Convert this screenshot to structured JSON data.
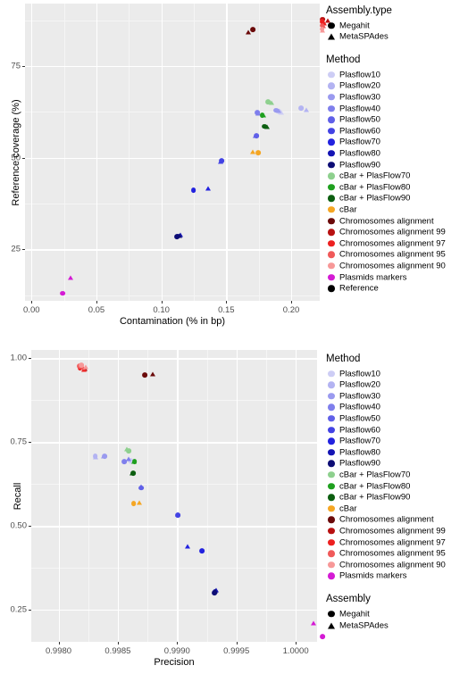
{
  "figure": {
    "palette": {
      "panel_bg": "#ebebeb",
      "grid_major": "#ffffff",
      "grid_minor": "#f5f5f5",
      "tick_text": "#4d4d4d",
      "axis_text": "#000000"
    },
    "method_colors": {
      "Plasflow10": "#cdcdf5",
      "Plasflow20": "#b3b3f2",
      "Plasflow30": "#9a9aef",
      "Plasflow40": "#7f7fec",
      "Plasflow50": "#6060e8",
      "Plasflow60": "#4343e4",
      "Plasflow70": "#2222df",
      "Plasflow80": "#1414b4",
      "Plasflow90": "#0d0d75",
      "cBar + PlasFlow70": "#8ed08e",
      "cBar + PlasFlow80": "#1fa01f",
      "cBar + PlasFlow90": "#0c5e10",
      "cBar": "#f5a623",
      "Chromosomes alignment": "#6b0a0a",
      "Chromosomes alignment 99": "#b81111",
      "Chromosomes alignment 97": "#ed2020",
      "Chromosomes alignment 95": "#f05a5a",
      "Chromosomes alignment 90": "#f79898",
      "Plasmids markers": "#d41bd4",
      "Reference": "#000000"
    },
    "assembly_shapes": {
      "Megahit": "circle",
      "MetaSPAdes": "triangle"
    }
  },
  "chart_data": [
    {
      "id": "top",
      "type": "scatter",
      "title": "",
      "xlabel": "Contamination (% in bp)",
      "ylabel": "Reference coverage (%)",
      "xlim": [
        -0.005,
        0.222
      ],
      "ylim": [
        11.0,
        92.0
      ],
      "xticks": [
        0.0,
        0.05,
        0.1,
        0.15,
        0.2
      ],
      "xtick_labels": [
        "0.00",
        "0.05",
        "0.10",
        "0.15",
        "0.20"
      ],
      "yticks": [
        25,
        50,
        75
      ],
      "ytick_labels": [
        "25",
        "50",
        "75"
      ],
      "grid": true,
      "legend_position": "right",
      "legends": [
        "Assembly.type",
        "Method"
      ],
      "points": [
        {
          "method": "Plasflow10",
          "assembly": "Megahit",
          "x": 0.1715,
          "y": 63.5
        },
        {
          "method": "Plasflow10",
          "assembly": "MetaSPAdes",
          "x": 0.1735,
          "y": 63.4
        },
        {
          "method": "Plasflow20",
          "assembly": "Megahit",
          "x": 0.1885,
          "y": 64.4
        },
        {
          "method": "Plasflow20",
          "assembly": "MetaSPAdes",
          "x": 0.1925,
          "y": 64.0
        },
        {
          "method": "Plasflow30",
          "assembly": "Megahit",
          "x": 0.169,
          "y": 63.9
        },
        {
          "method": "Plasflow30",
          "assembly": "MetaSPAdes",
          "x": 0.171,
          "y": 63.8
        },
        {
          "method": "Plasflow40",
          "assembly": "Megahit",
          "x": 0.1545,
          "y": 63.3
        },
        {
          "method": "Plasflow40",
          "assembly": "MetaSPAdes",
          "x": 0.1555,
          "y": 63.1
        },
        {
          "method": "Plasflow50",
          "assembly": "Megahit",
          "x": 0.154,
          "y": 57.0
        },
        {
          "method": "Plasflow50",
          "assembly": "MetaSPAdes",
          "x": 0.153,
          "y": 56.9
        },
        {
          "method": "Plasflow60",
          "assembly": "Megahit",
          "x": 0.127,
          "y": 50.1
        },
        {
          "method": "Plasflow60",
          "assembly": "MetaSPAdes",
          "x": 0.1265,
          "y": 50.0
        },
        {
          "method": "Plasflow70",
          "assembly": "Megahit",
          "x": 0.1055,
          "y": 42.1
        },
        {
          "method": "Plasflow70",
          "assembly": "MetaSPAdes",
          "x": 0.1165,
          "y": 42.6
        },
        {
          "method": "Plasflow80",
          "assembly": "Megahit",
          "x": 0.0935,
          "y": 29.6
        },
        {
          "method": "Plasflow80",
          "assembly": "MetaSPAdes",
          "x": 0.0955,
          "y": 30.0
        },
        {
          "method": "Plasflow90",
          "assembly": "Megahit",
          "x": 0.093,
          "y": 29.5
        },
        {
          "method": "Plasflow90",
          "assembly": "MetaSPAdes",
          "x": 0.095,
          "y": 29.8
        },
        {
          "method": "cBar + PlasFlow70",
          "assembly": "Megahit",
          "x": 0.163,
          "y": 66.2
        },
        {
          "method": "cBar + PlasFlow70",
          "assembly": "MetaSPAdes",
          "x": 0.1655,
          "y": 66.0
        },
        {
          "method": "cBar + PlasFlow80",
          "assembly": "Megahit",
          "x": 0.1585,
          "y": 62.6
        },
        {
          "method": "cBar + PlasFlow80",
          "assembly": "MetaSPAdes",
          "x": 0.1595,
          "y": 62.5
        },
        {
          "method": "cBar + PlasFlow90",
          "assembly": "Megahit",
          "x": 0.16,
          "y": 59.5
        },
        {
          "method": "cBar + PlasFlow90",
          "assembly": "MetaSPAdes",
          "x": 0.162,
          "y": 59.5
        },
        {
          "method": "cBar",
          "assembly": "Megahit",
          "x": 0.1555,
          "y": 52.3
        },
        {
          "method": "cBar",
          "assembly": "MetaSPAdes",
          "x": 0.151,
          "y": 52.5
        },
        {
          "method": "Chromosomes alignment",
          "assembly": "Megahit",
          "x": 0.151,
          "y": 85.9
        },
        {
          "method": "Chromosomes alignment",
          "assembly": "MetaSPAdes",
          "x": 0.1475,
          "y": 85.3
        },
        {
          "method": "Chromosomes alignment 99",
          "assembly": "Megahit",
          "x": 0.205,
          "y": 88.7
        },
        {
          "method": "Chromosomes alignment 99",
          "assembly": "MetaSPAdes",
          "x": 0.209,
          "y": 88.3
        },
        {
          "method": "Chromosomes alignment 97",
          "assembly": "Megahit",
          "x": 0.2045,
          "y": 88.0
        },
        {
          "method": "Chromosomes alignment 97",
          "assembly": "MetaSPAdes",
          "x": 0.2065,
          "y": 87.6
        },
        {
          "method": "Chromosomes alignment 95",
          "assembly": "Megahit",
          "x": 0.2045,
          "y": 87.0
        },
        {
          "method": "Chromosomes alignment 95",
          "assembly": "MetaSPAdes",
          "x": 0.2055,
          "y": 86.8
        },
        {
          "method": "Chromosomes alignment 90",
          "assembly": "Megahit",
          "x": 0.2045,
          "y": 86.0
        },
        {
          "method": "Chromosomes alignment 90",
          "assembly": "MetaSPAdes",
          "x": 0.205,
          "y": 85.7
        },
        {
          "method": "Plasmids markers",
          "assembly": "Megahit",
          "x": 0.0045,
          "y": 14.0
        },
        {
          "method": "Plasmids markers",
          "assembly": "MetaSPAdes",
          "x": 0.0105,
          "y": 18.2
        }
      ]
    },
    {
      "id": "bottom",
      "type": "scatter",
      "title": "",
      "xlabel": "Precision",
      "ylabel": "Recall",
      "xlim": [
        0.99777,
        1.00018
      ],
      "ylim": [
        0.155,
        1.025
      ],
      "xticks": [
        0.998,
        0.9985,
        0.999,
        0.9995,
        1.0
      ],
      "xtick_labels": [
        "0.9980",
        "0.9985",
        "0.9990",
        "0.9995",
        "1.0000"
      ],
      "yticks": [
        0.25,
        0.5,
        0.75,
        1.0
      ],
      "ytick_labels": [
        "0.25",
        "0.50",
        "0.75",
        "1.00"
      ],
      "grid": true,
      "legend_position": "right",
      "legends": [
        "Method",
        "Assembly"
      ],
      "points": [
        {
          "method": "Plasflow10",
          "assembly": "Megahit",
          "x": 0.998345,
          "y": 0.717
        },
        {
          "method": "Plasflow10",
          "assembly": "MetaSPAdes",
          "x": 0.99836,
          "y": 0.715
        },
        {
          "method": "Plasflow20",
          "assembly": "Megahit",
          "x": 0.998045,
          "y": 0.73
        },
        {
          "method": "Plasflow20",
          "assembly": "MetaSPAdes",
          "x": 0.99805,
          "y": 0.728
        },
        {
          "method": "Plasflow30",
          "assembly": "Megahit",
          "x": 0.998125,
          "y": 0.73
        },
        {
          "method": "Plasflow30",
          "assembly": "MetaSPAdes",
          "x": 0.998118,
          "y": 0.729
        },
        {
          "method": "Plasflow40",
          "assembly": "Megahit",
          "x": 0.99829,
          "y": 0.714
        },
        {
          "method": "Plasflow40",
          "assembly": "MetaSPAdes",
          "x": 0.998325,
          "y": 0.722
        },
        {
          "method": "Plasflow50",
          "assembly": "Megahit",
          "x": 0.998432,
          "y": 0.635
        },
        {
          "method": "Plasflow50",
          "assembly": "MetaSPAdes",
          "x": 0.99843,
          "y": 0.64
        },
        {
          "method": "Plasflow60",
          "assembly": "Megahit",
          "x": 0.998745,
          "y": 0.553
        },
        {
          "method": "Plasflow60",
          "assembly": "MetaSPAdes",
          "x": 0.99874,
          "y": 0.556
        },
        {
          "method": "Plasflow70",
          "assembly": "Megahit",
          "x": 0.998945,
          "y": 0.448
        },
        {
          "method": "Plasflow70",
          "assembly": "MetaSPAdes",
          "x": 0.998825,
          "y": 0.462
        },
        {
          "method": "Plasflow80",
          "assembly": "Megahit",
          "x": 0.999055,
          "y": 0.325
        },
        {
          "method": "Plasflow80",
          "assembly": "MetaSPAdes",
          "x": 0.999062,
          "y": 0.33
        },
        {
          "method": "Plasflow90",
          "assembly": "Megahit",
          "x": 0.99905,
          "y": 0.323
        },
        {
          "method": "Plasflow90",
          "assembly": "MetaSPAdes",
          "x": 0.999058,
          "y": 0.328
        },
        {
          "method": "cBar + PlasFlow70",
          "assembly": "Megahit",
          "x": 0.99833,
          "y": 0.746
        },
        {
          "method": "cBar + PlasFlow70",
          "assembly": "MetaSPAdes",
          "x": 0.998312,
          "y": 0.75
        },
        {
          "method": "cBar + PlasFlow80",
          "assembly": "Megahit",
          "x": 0.998378,
          "y": 0.713
        },
        {
          "method": "cBar + PlasFlow80",
          "assembly": "MetaSPAdes",
          "x": 0.998372,
          "y": 0.715
        },
        {
          "method": "cBar + PlasFlow90",
          "assembly": "Megahit",
          "x": 0.998368,
          "y": 0.678
        },
        {
          "method": "cBar + PlasFlow90",
          "assembly": "MetaSPAdes",
          "x": 0.998355,
          "y": 0.68
        },
        {
          "method": "cBar",
          "assembly": "Megahit",
          "x": 0.99837,
          "y": 0.588
        },
        {
          "method": "cBar",
          "assembly": "MetaSPAdes",
          "x": 0.998415,
          "y": 0.592
        },
        {
          "method": "Chromosomes alignment",
          "assembly": "Megahit",
          "x": 0.998465,
          "y": 0.972
        },
        {
          "method": "Chromosomes alignment",
          "assembly": "MetaSPAdes",
          "x": 0.99853,
          "y": 0.975
        },
        {
          "method": "Chromosomes alignment 99",
          "assembly": "Megahit",
          "x": 0.997925,
          "y": 0.995
        },
        {
          "method": "Chromosomes alignment 99",
          "assembly": "MetaSPAdes",
          "x": 0.99796,
          "y": 0.99
        },
        {
          "method": "Chromosomes alignment 97",
          "assembly": "Megahit",
          "x": 0.997918,
          "y": 0.992
        },
        {
          "method": "Chromosomes alignment 97",
          "assembly": "MetaSPAdes",
          "x": 0.997952,
          "y": 0.988
        },
        {
          "method": "Chromosomes alignment 95",
          "assembly": "Megahit",
          "x": 0.997915,
          "y": 0.998
        },
        {
          "method": "Chromosomes alignment 95",
          "assembly": "MetaSPAdes",
          "x": 0.997945,
          "y": 0.994
        },
        {
          "method": "Chromosomes alignment 90",
          "assembly": "Megahit",
          "x": 0.99793,
          "y": 1.0
        },
        {
          "method": "Chromosomes alignment 90",
          "assembly": "MetaSPAdes",
          "x": 0.997968,
          "y": 0.997
        },
        {
          "method": "Plasmids markers",
          "assembly": "Megahit",
          "x": 0.99996,
          "y": 0.192
        },
        {
          "method": "Plasmids markers",
          "assembly": "MetaSPAdes",
          "x": 0.99989,
          "y": 0.232
        }
      ]
    }
  ],
  "legends": {
    "top": [
      {
        "title": "Assembly.type",
        "items": [
          {
            "label": "Megahit",
            "shape": "circle",
            "color": "#000000"
          },
          {
            "label": "MetaSPAdes",
            "shape": "triangle",
            "color": "#000000"
          }
        ]
      },
      {
        "title": "Method",
        "items": [
          {
            "label": "Plasflow10",
            "shape": "circle",
            "color": "#cdcdf5"
          },
          {
            "label": "Plasflow20",
            "shape": "circle",
            "color": "#b3b3f2"
          },
          {
            "label": "Plasflow30",
            "shape": "circle",
            "color": "#9a9aef"
          },
          {
            "label": "Plasflow40",
            "shape": "circle",
            "color": "#7f7fec"
          },
          {
            "label": "Plasflow50",
            "shape": "circle",
            "color": "#6060e8"
          },
          {
            "label": "Plasflow60",
            "shape": "circle",
            "color": "#4343e4"
          },
          {
            "label": "Plasflow70",
            "shape": "circle",
            "color": "#2222df"
          },
          {
            "label": "Plasflow80",
            "shape": "circle",
            "color": "#1414b4"
          },
          {
            "label": "Plasflow90",
            "shape": "circle",
            "color": "#0d0d75"
          },
          {
            "label": "cBar + PlasFlow70",
            "shape": "circle",
            "color": "#8ed08e"
          },
          {
            "label": "cBar + PlasFlow80",
            "shape": "circle",
            "color": "#1fa01f"
          },
          {
            "label": "cBar + PlasFlow90",
            "shape": "circle",
            "color": "#0c5e10"
          },
          {
            "label": "cBar",
            "shape": "circle",
            "color": "#f5a623"
          },
          {
            "label": "Chromosomes alignment",
            "shape": "circle",
            "color": "#6b0a0a"
          },
          {
            "label": "Chromosomes alignment 99",
            "shape": "circle",
            "color": "#b81111"
          },
          {
            "label": "Chromosomes alignment 97",
            "shape": "circle",
            "color": "#ed2020"
          },
          {
            "label": "Chromosomes alignment 95",
            "shape": "circle",
            "color": "#f05a5a"
          },
          {
            "label": "Chromosomes alignment 90",
            "shape": "circle",
            "color": "#f79898"
          },
          {
            "label": "Plasmids markers",
            "shape": "circle",
            "color": "#d41bd4"
          },
          {
            "label": "Reference",
            "shape": "circle",
            "color": "#000000"
          }
        ]
      }
    ],
    "bottom": [
      {
        "title": "Method",
        "items": [
          {
            "label": "Plasflow10",
            "shape": "circle",
            "color": "#cdcdf5"
          },
          {
            "label": "Plasflow20",
            "shape": "circle",
            "color": "#b3b3f2"
          },
          {
            "label": "Plasflow30",
            "shape": "circle",
            "color": "#9a9aef"
          },
          {
            "label": "Plasflow40",
            "shape": "circle",
            "color": "#7f7fec"
          },
          {
            "label": "Plasflow50",
            "shape": "circle",
            "color": "#6060e8"
          },
          {
            "label": "Plasflow60",
            "shape": "circle",
            "color": "#4343e4"
          },
          {
            "label": "Plasflow70",
            "shape": "circle",
            "color": "#2222df"
          },
          {
            "label": "Plasflow80",
            "shape": "circle",
            "color": "#1414b4"
          },
          {
            "label": "Plasflow90",
            "shape": "circle",
            "color": "#0d0d75"
          },
          {
            "label": "cBar + PlasFlow70",
            "shape": "circle",
            "color": "#8ed08e"
          },
          {
            "label": "cBar + PlasFlow80",
            "shape": "circle",
            "color": "#1fa01f"
          },
          {
            "label": "cBar + PlasFlow90",
            "shape": "circle",
            "color": "#0c5e10"
          },
          {
            "label": "cBar",
            "shape": "circle",
            "color": "#f5a623"
          },
          {
            "label": "Chromosomes alignment",
            "shape": "circle",
            "color": "#6b0a0a"
          },
          {
            "label": "Chromosomes alignment 99",
            "shape": "circle",
            "color": "#b81111"
          },
          {
            "label": "Chromosomes alignment 97",
            "shape": "circle",
            "color": "#ed2020"
          },
          {
            "label": "Chromosomes alignment 95",
            "shape": "circle",
            "color": "#f05a5a"
          },
          {
            "label": "Chromosomes alignment 90",
            "shape": "circle",
            "color": "#f79898"
          },
          {
            "label": "Plasmids markers",
            "shape": "circle",
            "color": "#d41bd4"
          }
        ]
      },
      {
        "title": "Assembly",
        "items": [
          {
            "label": "Megahit",
            "shape": "circle",
            "color": "#000000"
          },
          {
            "label": "MetaSPAdes",
            "shape": "triangle",
            "color": "#000000"
          }
        ]
      }
    ]
  }
}
